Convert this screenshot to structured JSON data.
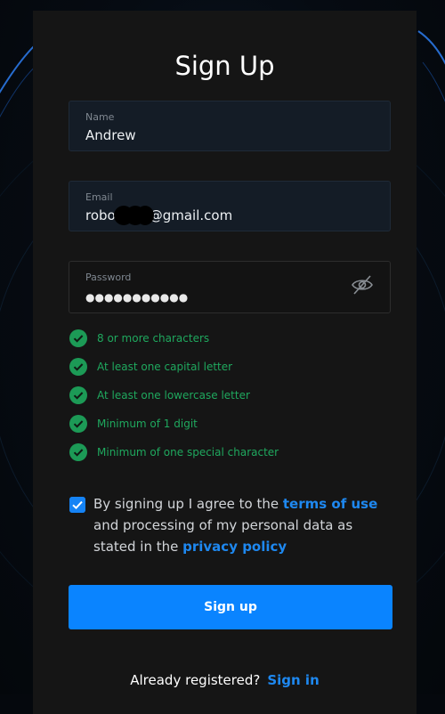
{
  "form": {
    "title": "Sign Up",
    "name": {
      "label": "Name",
      "value": "Andrew"
    },
    "email": {
      "label": "Email",
      "value_start": "robo",
      "value_end": "@gmail.com"
    },
    "password": {
      "label": "Password",
      "masked_value": "●●●●●●●●●●●",
      "visibility_icon": "eye-slash-icon"
    }
  },
  "password_rules": [
    {
      "text": "8 or more characters",
      "status": "met"
    },
    {
      "text": "At least one capital letter",
      "status": "met"
    },
    {
      "text": "At least one lowercase letter",
      "status": "met"
    },
    {
      "text": "Minimum of 1 digit",
      "status": "met"
    },
    {
      "text": "Minimum of one special character",
      "status": "met"
    }
  ],
  "consent": {
    "checked": true,
    "text_before": "By signing up I agree to the ",
    "terms_link": "terms of use",
    "text_middle": " and processing of my personal data as stated in the ",
    "privacy_link": "privacy policy"
  },
  "submit_label": "Sign up",
  "footer": {
    "prompt": "Already registered?",
    "signin_link": "Sign in"
  },
  "colors": {
    "accent": "#0a84ff",
    "success": "#1fa85e",
    "card": "#151515"
  }
}
